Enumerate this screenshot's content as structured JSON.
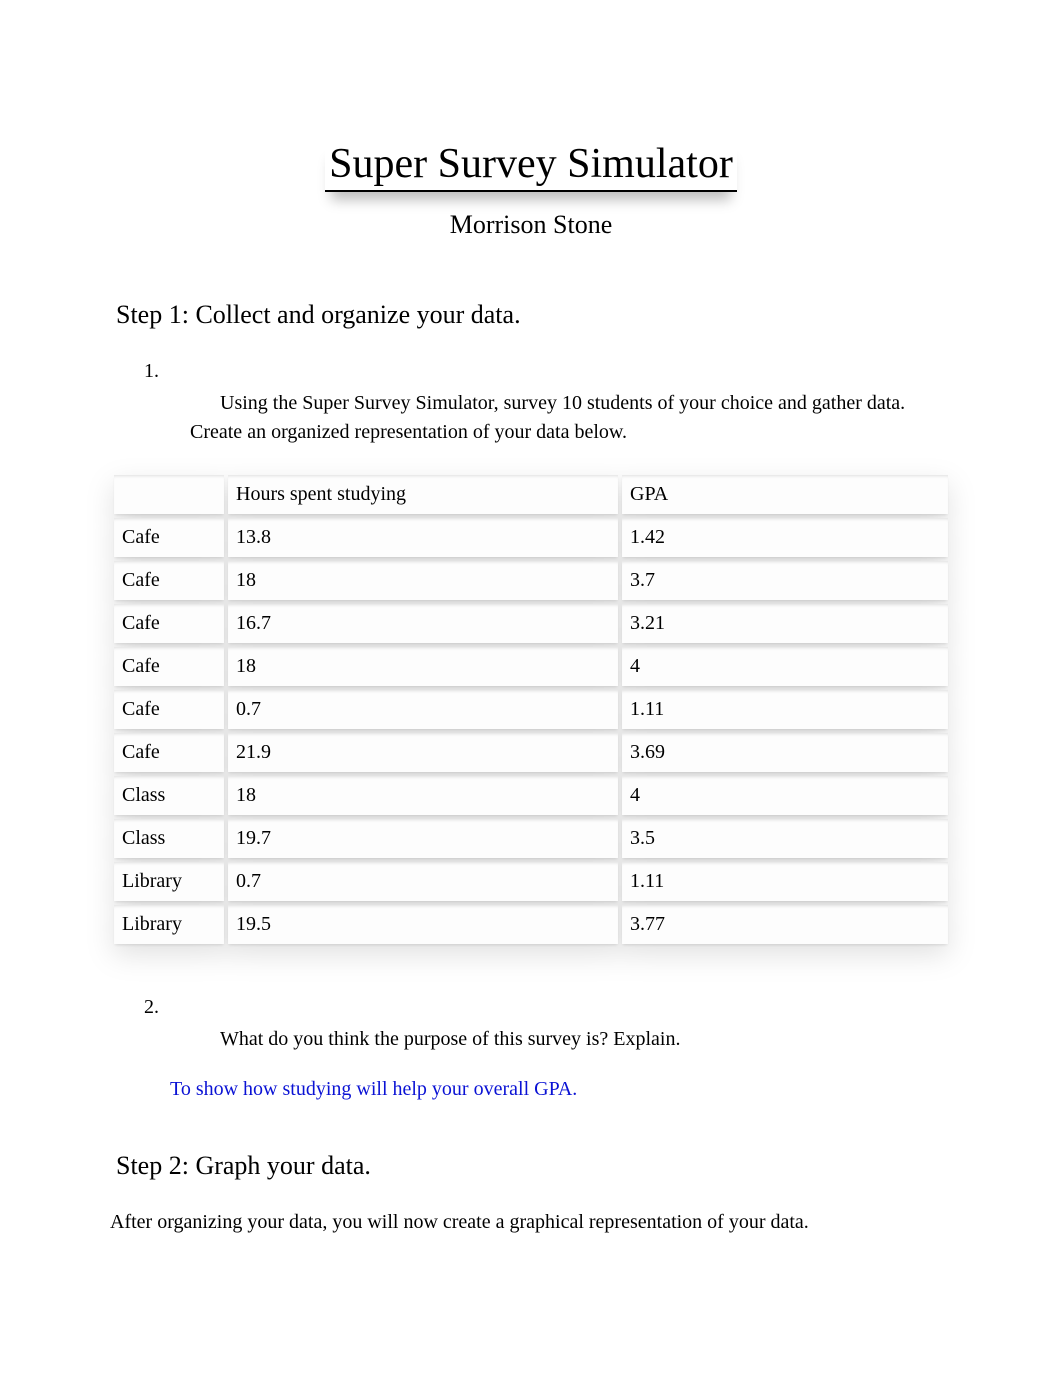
{
  "title": "Super Survey Simulator",
  "author": "Morrison Stone",
  "step1": {
    "heading": "Step 1: Collect and organize your data.",
    "q1_num": "1.",
    "q1_text": "Using the Super Survey Simulator, survey 10 students of your choice and gather data. Create an organized representation of your data below.",
    "q2_num": "2.",
    "q2_text": "What do you think the purpose of this survey is? Explain.",
    "q2_answer": "To show how studying will help your overall GPA."
  },
  "table": {
    "headers": {
      "col1": "",
      "col2": "Hours spent studying",
      "col3": "GPA"
    },
    "rows": [
      {
        "loc": "Cafe",
        "hours": "13.8",
        "gpa": "1.42"
      },
      {
        "loc": "Cafe",
        "hours": "18",
        "gpa": "3.7"
      },
      {
        "loc": "Cafe",
        "hours": "16.7",
        "gpa": "3.21"
      },
      {
        "loc": "Cafe",
        "hours": "18",
        "gpa": "4"
      },
      {
        "loc": "Cafe",
        "hours": "0.7",
        "gpa": "1.11"
      },
      {
        "loc": "Cafe",
        "hours": "21.9",
        "gpa": "3.69"
      },
      {
        "loc": "Class",
        "hours": "18",
        "gpa": "4"
      },
      {
        "loc": "Class",
        "hours": "19.7",
        "gpa": "3.5"
      },
      {
        "loc": "Library",
        "hours": "0.7",
        "gpa": "1.11"
      },
      {
        "loc": "Library",
        "hours": "19.5",
        "gpa": "3.77"
      }
    ]
  },
  "step2": {
    "heading": "Step 2: Graph your data.",
    "intro": "After organizing your data, you will now create a graphical representation of your data."
  }
}
